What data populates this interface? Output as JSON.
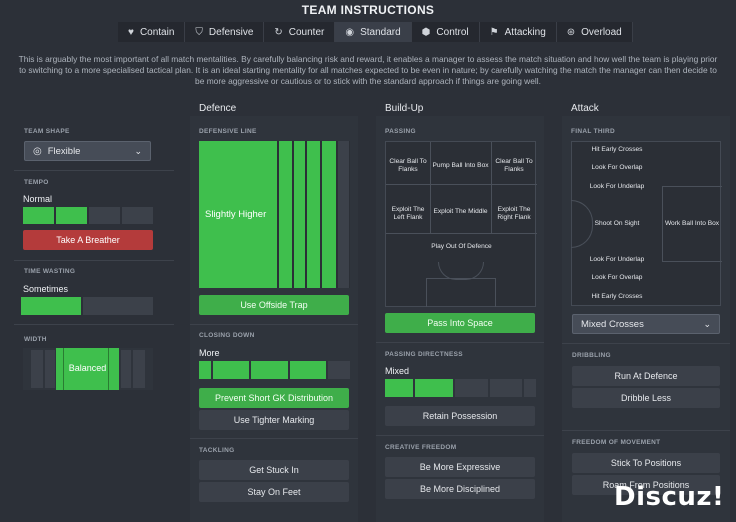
{
  "header": {
    "title": "TEAM INSTRUCTIONS",
    "tabs": [
      {
        "label": "Contain",
        "icon": "heart-shield-icon"
      },
      {
        "label": "Defensive",
        "icon": "shield-icon"
      },
      {
        "label": "Counter",
        "icon": "counter-arrow-icon"
      },
      {
        "label": "Standard",
        "icon": "ball-icon",
        "active": true
      },
      {
        "label": "Control",
        "icon": "control-icon"
      },
      {
        "label": "Attacking",
        "icon": "flag-icon"
      },
      {
        "label": "Overload",
        "icon": "overload-icon"
      }
    ],
    "description": "This is arguably the most important of all match mentalities. By carefully balancing risk and reward, it enables a manager to assess the match situation and how well the team is playing prior to switching to a more specialised tactical plan. It is an ideal starting mentality for all matches expected to be even in nature; by carefully watching the match the manager can then decide to be more aggressive or cautious or to stick with the standard approach if things are going well."
  },
  "columns": {
    "defence": "Defence",
    "buildup": "Build-Up",
    "attack": "Attack"
  },
  "left": {
    "team_shape_label": "TEAM SHAPE",
    "team_shape_value": "Flexible",
    "tempo_label": "TEMPO",
    "tempo_value": "Normal",
    "tempo_level": 0.5,
    "tempo_button": "Take A Breather",
    "time_wasting_label": "TIME WASTING",
    "time_wasting_value": "Sometimes",
    "time_wasting_level": 0.45,
    "width_label": "WIDTH",
    "width_value": "Balanced"
  },
  "defence": {
    "defensive_line_label": "DEFENSIVE LINE",
    "defensive_line_value": "Slightly Higher",
    "offside_trap_button": "Use Offside Trap",
    "closing_down_label": "CLOSING DOWN",
    "closing_down_value": "More",
    "closing_down_level": 0.6,
    "prevent_gk_button": "Prevent Short GK Distribution",
    "tighter_marking_button": "Use Tighter Marking",
    "tackling_label": "TACKLING",
    "get_stuck_in_button": "Get Stuck In",
    "stay_on_feet_button": "Stay On Feet"
  },
  "buildup": {
    "passing_label": "PASSING",
    "pitch": {
      "clear_left": "Clear Ball To Flanks",
      "pump_ball": "Pump Ball Into Box",
      "clear_right": "Clear Ball To Flanks",
      "exploit_left": "Exploit The Left Flank",
      "exploit_middle": "Exploit The Middle",
      "exploit_right": "Exploit The Right Flank",
      "play_out": "Play Out Of Defence"
    },
    "pass_into_space_button": "Pass Into Space",
    "passing_directness_label": "PASSING DIRECTNESS",
    "passing_directness_value": "Mixed",
    "passing_directness_level": 0.4,
    "retain_possession_button": "Retain Possession",
    "creative_freedom_label": "CREATIVE FREEDOM",
    "more_expressive_button": "Be More Expressive",
    "more_disciplined_button": "Be More Disciplined"
  },
  "attack": {
    "final_third_label": "FINAL THIRD",
    "pitch": {
      "hit_early_top": "Hit Early Crosses",
      "overlap_top": "Look For Overlap",
      "underlap_top": "Look For Underlap",
      "shoot_on_sight": "Shoot On Sight",
      "work_ball": "Work Ball Into Box",
      "underlap_bottom": "Look For Underlap",
      "overlap_bottom": "Look For Overlap",
      "hit_early_bottom": "Hit Early Crosses"
    },
    "crosses_select": "Mixed Crosses",
    "dribbling_label": "DRIBBLING",
    "run_at_defence_button": "Run At Defence",
    "dribble_less_button": "Dribble Less",
    "freedom_label": "FREEDOM OF MOVEMENT",
    "stick_positions_button": "Stick To Positions",
    "roam_positions_button": "Roam From Positions"
  },
  "watermark": "Discuz!",
  "colors": {
    "accent_green": "#3fbf4d",
    "button_green": "#3fae4a",
    "button_red": "#b43b3b",
    "background": "#2c3038"
  }
}
